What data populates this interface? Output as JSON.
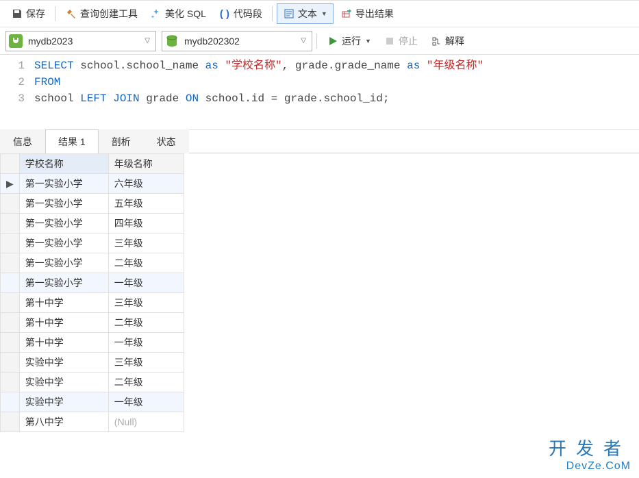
{
  "toolbar1": {
    "save": "保存",
    "queryBuilder": "查询创建工具",
    "beautify": "美化 SQL",
    "snippet": "代码段",
    "text": "文本",
    "export": "导出结果"
  },
  "toolbar2": {
    "connection": "mydb2023",
    "database": "mydb202302",
    "run": "运行",
    "stop": "停止",
    "explain": "解释"
  },
  "sql": {
    "lines": [
      "1",
      "2",
      "3"
    ],
    "l1_select": "SELECT",
    "l1_a": " school.school_name ",
    "l1_as1": "as",
    "l1_s1": " \"学校名称\"",
    "l1_comma": ", grade.grade_name ",
    "l1_as2": "as",
    "l1_s2": " \"年级名称\"",
    "l2_from": "FROM",
    "l3_a": "school ",
    "l3_left": "LEFT",
    "l3_sp1": " ",
    "l3_join": "JOIN",
    "l3_b": " grade ",
    "l3_on": "ON",
    "l3_c": " school.id = grade.school_id;"
  },
  "tabs": {
    "info": "信息",
    "result": "结果 1",
    "profile": "剖析",
    "status": "状态"
  },
  "grid": {
    "columns": [
      "学校名称",
      "年级名称"
    ],
    "rows": [
      {
        "c1": "第一实验小学",
        "c2": "六年级",
        "sel": true
      },
      {
        "c1": "第一实验小学",
        "c2": "五年级"
      },
      {
        "c1": "第一实验小学",
        "c2": "四年级"
      },
      {
        "c1": "第一实验小学",
        "c2": "三年级"
      },
      {
        "c1": "第一实验小学",
        "c2": "二年级"
      },
      {
        "c1": "第一实验小学",
        "c2": "一年级",
        "sel": true
      },
      {
        "c1": "第十中学",
        "c2": "三年级"
      },
      {
        "c1": "第十中学",
        "c2": "二年级"
      },
      {
        "c1": "第十中学",
        "c2": "一年级"
      },
      {
        "c1": "实验中学",
        "c2": "三年级"
      },
      {
        "c1": "实验中学",
        "c2": "二年级"
      },
      {
        "c1": "实验中学",
        "c2": "一年级",
        "sel": true
      },
      {
        "c1": "第八中学",
        "c2": "(Null)",
        "null": true
      }
    ]
  },
  "watermark": {
    "cn": "开发者",
    "en": "DevZe.CoM"
  }
}
